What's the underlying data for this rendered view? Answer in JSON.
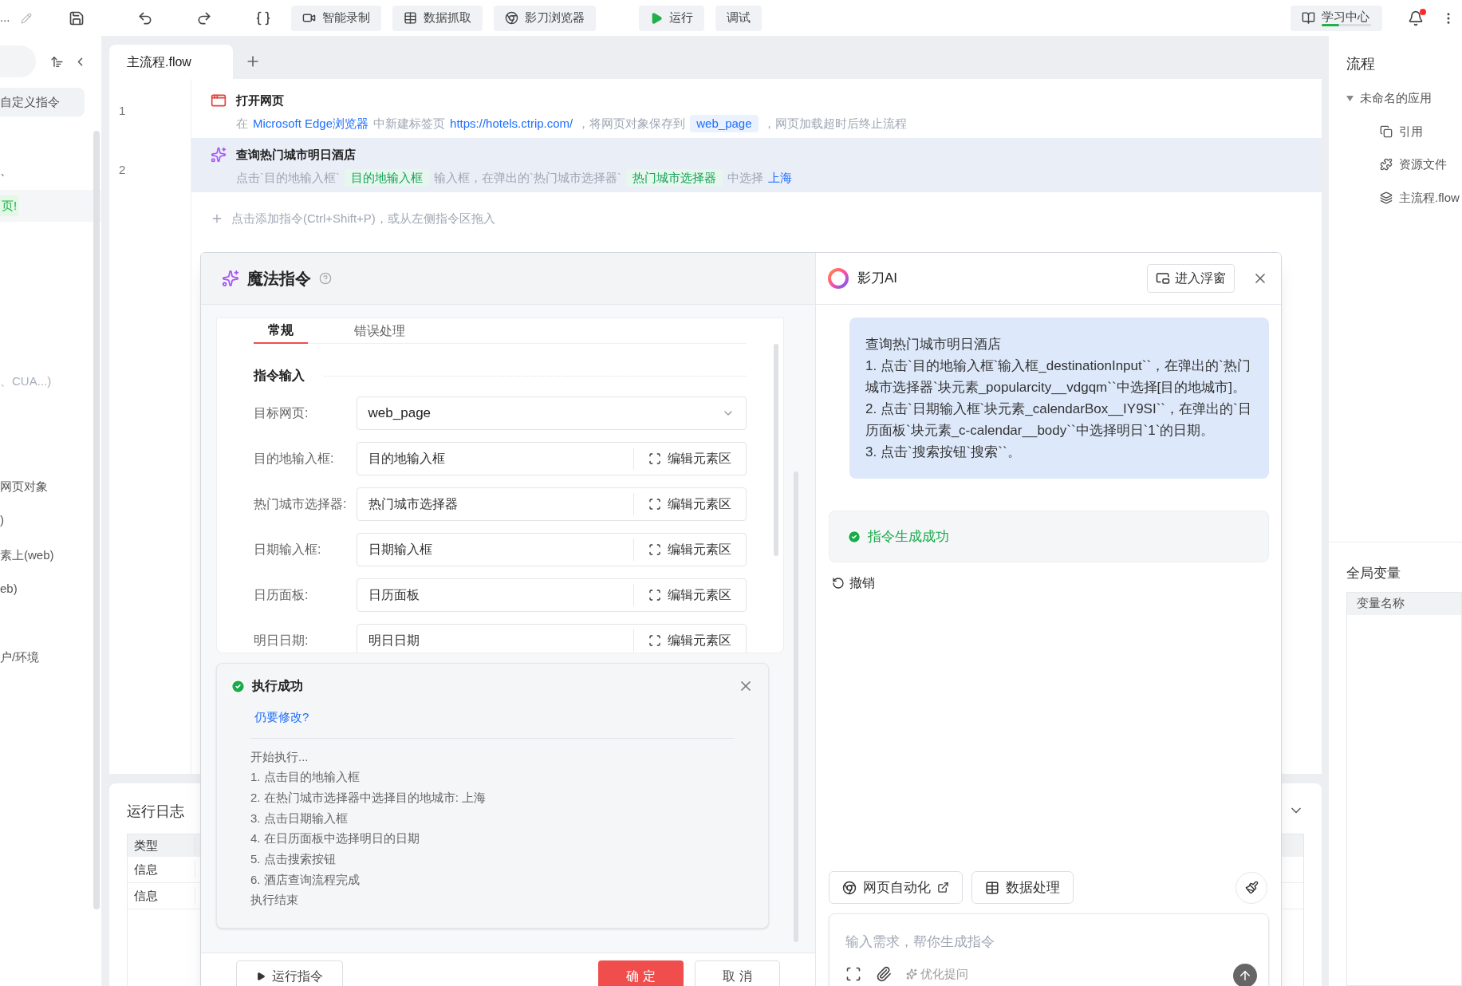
{
  "toolbar": {
    "lead": "...",
    "buttons": [
      {
        "label": "智能录制",
        "kind": "record"
      },
      {
        "label": "数据抓取",
        "kind": "scrape"
      },
      {
        "label": "影刀浏览器",
        "kind": "browser"
      },
      {
        "label": "运行",
        "kind": "run"
      },
      {
        "label": "调试",
        "kind": "debug"
      }
    ],
    "learning": {
      "label": "学习中心",
      "level": 0.35
    },
    "has_notification": true
  },
  "sidebar": {
    "items": [
      {
        "label": "自定义指令",
        "kind": "button"
      },
      {
        "label": "、",
        "kind": "text"
      },
      {
        "label": "页!",
        "kind": "badge"
      },
      {
        "label": "、CUA...)",
        "kind": "hint"
      },
      {
        "label": "网页对象",
        "kind": "text"
      },
      {
        "label": ")",
        "kind": "text"
      },
      {
        "label": "素上(web)",
        "kind": "text"
      },
      {
        "label": "eb)",
        "kind": "text"
      },
      {
        "label": "户/环境",
        "kind": "text"
      }
    ]
  },
  "tabs": [
    {
      "label": "主流程.flow",
      "selected": true
    }
  ],
  "steps": [
    {
      "number": "1",
      "kind": "open_page",
      "title": "打开网页",
      "selected": false,
      "parts": [
        {
          "text": "在",
          "kind": "plain"
        },
        {
          "text": "Microsoft Edge浏览器",
          "kind": "link"
        },
        {
          "text": "中新建标签页",
          "kind": "plain"
        },
        {
          "text": "https://hotels.ctrip.com/",
          "kind": "link"
        },
        {
          "text": "，将网页对象保存到",
          "kind": "plain"
        },
        {
          "text": "web_page",
          "kind": "var"
        },
        {
          "text": "，网页加载超时后终止流程",
          "kind": "plain"
        }
      ]
    },
    {
      "number": "2",
      "kind": "magic",
      "title": "查询热门城市明日酒店",
      "selected": true,
      "parts": [
        {
          "text": "点击`目的地输入框`",
          "kind": "plain"
        },
        {
          "text": "目的地输入框",
          "kind": "element"
        },
        {
          "text": "输入框，在弹出的`热门城市选择器`",
          "kind": "plain"
        },
        {
          "text": "热门城市选择器",
          "kind": "element"
        },
        {
          "text": "中选择",
          "kind": "plain"
        },
        {
          "text": "上海",
          "kind": "link"
        }
      ]
    }
  ],
  "add_hint": "点击添加指令(Ctrl+Shift+P)，或从左侧指令区拖入",
  "log": {
    "title": "运行日志",
    "column": "类型",
    "rows": [
      "信息",
      "信息"
    ]
  },
  "right_panel": {
    "title": "流程",
    "tree": {
      "label": "未命名的应用",
      "expanded": true,
      "children": [
        {
          "label": "引用",
          "kind": "reference"
        },
        {
          "label": "资源文件",
          "kind": "resource"
        },
        {
          "label": "主流程.flow",
          "kind": "flow"
        }
      ]
    },
    "globals_title": "全局变量",
    "globals_column": "变量名称"
  },
  "dialog": {
    "title": "魔法指令",
    "tabs": [
      {
        "label": "常规",
        "selected": true
      },
      {
        "label": "错误处理",
        "selected": false
      }
    ],
    "section": "指令输入",
    "fields": [
      {
        "label": "目标网页:",
        "value": "web_page",
        "kind": "select"
      },
      {
        "label": "目的地输入框:",
        "value": "目的地输入框",
        "kind": "element",
        "action": "编辑元素区"
      },
      {
        "label": "热门城市选择器:",
        "value": "热门城市选择器",
        "kind": "element",
        "action": "编辑元素区"
      },
      {
        "label": "日期输入框:",
        "value": "日期输入框",
        "kind": "element",
        "action": "编辑元素区"
      },
      {
        "label": "日历面板:",
        "value": "日历面板",
        "kind": "element",
        "action": "编辑元素区"
      },
      {
        "label": "明日日期:",
        "value": "明日日期",
        "kind": "element",
        "action": "编辑元素区"
      }
    ],
    "result": {
      "title": "执行成功",
      "link": "仍要修改?",
      "lines": [
        "开始执行...",
        "1. 点击目的地输入框",
        "2. 在热门城市选择器中选择目的地城市: 上海",
        "3. 点击日期输入框",
        "4. 在日历面板中选择明日的日期",
        "5. 点击搜索按钮",
        "6. 酒店查询流程完成",
        "执行结束"
      ]
    },
    "run_button": "运行指令",
    "ok_button": "确 定",
    "cancel_button": "取 消"
  },
  "ai": {
    "title": "影刀AI",
    "float_button": "进入浮窗",
    "message": [
      "查询热门城市明日酒店",
      "1. 点击`目的地输入框`输入框_destinationInput``，在弹出的`热门城市选择器`块元素_popularcity__vdgqm``中选择[目的地城市]。",
      "2. 点击`日期输入框`块元素_calendarBox__IY9SI``，在弹出的`日历面板`块元素_c-calendar__body``中选择明日`1`的日期。",
      "3. 点击`搜索按钮`搜索``。"
    ],
    "status": "指令生成成功",
    "undo": "撤销",
    "chips": [
      {
        "label": "网页自动化",
        "kind": "web",
        "external": true
      },
      {
        "label": "数据处理",
        "kind": "data",
        "external": false
      }
    ],
    "input_placeholder": "输入需求，帮你生成指令",
    "optimize": "优化提问"
  }
}
